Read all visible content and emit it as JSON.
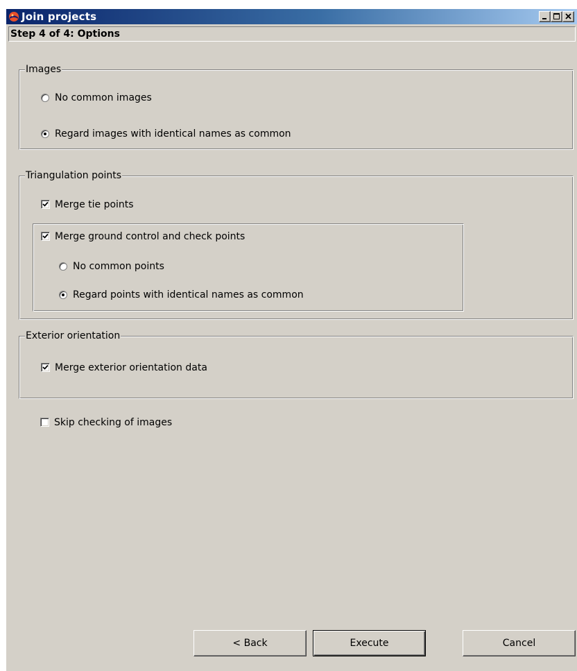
{
  "window": {
    "title": "Join projects",
    "controls": {
      "minimize_icon": "minimize-icon",
      "maximize_icon": "maximize-icon",
      "close_icon": "close-icon"
    }
  },
  "step_header": "Step 4 of 4: Options",
  "groups": {
    "images": {
      "legend": "Images",
      "options": [
        {
          "label": "No common images",
          "checked": false
        },
        {
          "label": "Regard images with identical names as common",
          "checked": true
        }
      ]
    },
    "triangulation": {
      "legend": "Triangulation points",
      "merge_tie_points": {
        "label": "Merge tie points",
        "checked": true
      },
      "merge_gcp": {
        "label": "Merge ground control and check points",
        "checked": true
      },
      "gcp_options": [
        {
          "label": "No common points",
          "checked": false
        },
        {
          "label": "Regard points with identical names as common",
          "checked": true
        }
      ]
    },
    "exterior": {
      "legend": "Exterior orientation",
      "merge_exterior": {
        "label": "Merge exterior orientation data",
        "checked": true
      }
    }
  },
  "skip_checking": {
    "label": "Skip checking of images",
    "checked": false
  },
  "buttons": {
    "back": "< Back",
    "execute": "Execute",
    "cancel": "Cancel"
  },
  "colors": {
    "face": "#d4d0c8",
    "title_start": "#0a246a",
    "title_end": "#a6caf0"
  }
}
